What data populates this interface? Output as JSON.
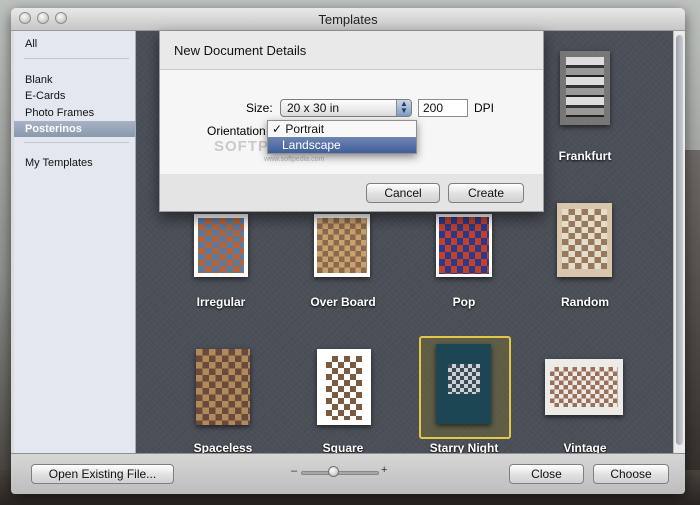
{
  "window": {
    "title": "Templates"
  },
  "sidebar": {
    "items": [
      {
        "label": "All"
      },
      {
        "label": "Blank"
      },
      {
        "label": "E-Cards"
      },
      {
        "label": "Photo Frames"
      },
      {
        "label": "Posterinos"
      },
      {
        "label": "My Templates"
      }
    ],
    "selected": "Posterinos"
  },
  "templates": [
    {
      "label": "Frankfurt"
    },
    {
      "label": "Irregular"
    },
    {
      "label": "Over Board"
    },
    {
      "label": "Pop"
    },
    {
      "label": "Random"
    },
    {
      "label": "Spaceless"
    },
    {
      "label": "Square"
    },
    {
      "label": "Starry Night"
    },
    {
      "label": "Vintage"
    }
  ],
  "selected_template": "Starry Night",
  "dialog": {
    "title": "New Document Details",
    "size_label": "Size:",
    "size_value": "20 x 30 in",
    "dpi_value": "200",
    "dpi_label": "DPI",
    "orientation_label": "Orientation",
    "orientation_options": [
      {
        "label": "✓ Portrait"
      },
      {
        "label": "Landscape"
      }
    ],
    "cancel_label": "Cancel",
    "create_label": "Create",
    "watermark": "SOFTPEDIA",
    "watermark_small": "www.softpedia.com"
  },
  "bottom": {
    "open_label": "Open Existing File...",
    "zoom_minus": "–",
    "zoom_plus": "+",
    "close_label": "Close",
    "choose_label": "Choose"
  },
  "colors": {
    "selection": "#e2c84a",
    "grid_bg": "#4b4f57",
    "sidebar_bg": "#e3e8f0"
  }
}
